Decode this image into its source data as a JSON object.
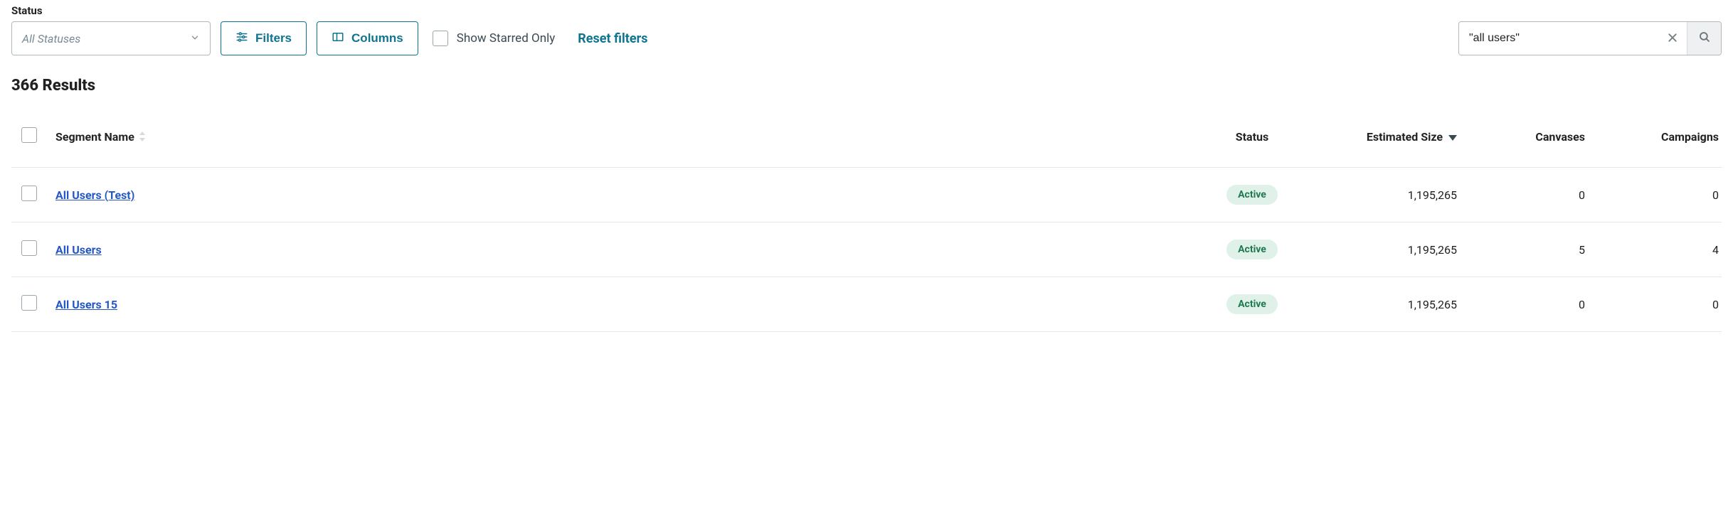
{
  "filters": {
    "label": "Status",
    "status_placeholder": "All Statuses",
    "filters_btn": "Filters",
    "columns_btn": "Columns",
    "starred_label": "Show Starred Only",
    "reset_label": "Reset filters",
    "search_value": "\"all users\""
  },
  "results_text": "366 Results",
  "columns": {
    "name": "Segment Name",
    "status": "Status",
    "size": "Estimated Size",
    "canvases": "Canvases",
    "campaigns": "Campaigns"
  },
  "rows": [
    {
      "name": "All Users (Test)",
      "status": "Active",
      "size": "1,195,265",
      "canvases": "0",
      "campaigns": "0"
    },
    {
      "name": "All Users",
      "status": "Active",
      "size": "1,195,265",
      "canvases": "5",
      "campaigns": "4"
    },
    {
      "name": "All Users 15",
      "status": "Active",
      "size": "1,195,265",
      "canvases": "0",
      "campaigns": "0"
    }
  ]
}
